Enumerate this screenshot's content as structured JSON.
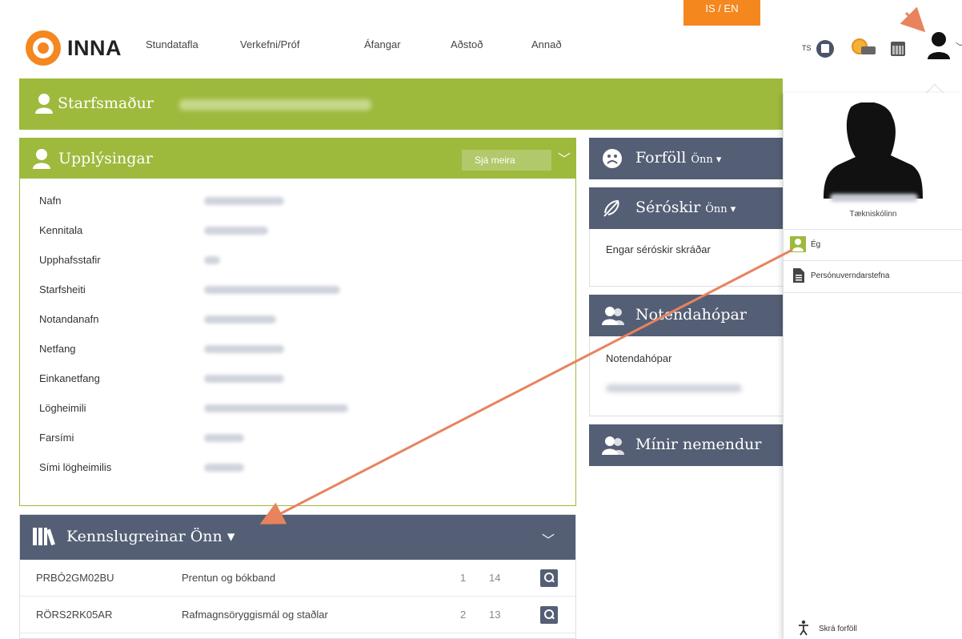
{
  "header": {
    "lang_label": "IS / EN",
    "logo_text": "INNA",
    "nav": [
      "Stundatafla",
      "Verkefni/Próf",
      "Áfangar",
      "Aðstoð",
      "Annað"
    ],
    "ts_label": "TS"
  },
  "employee": {
    "title": "Starfsmaður"
  },
  "info_card": {
    "title": "Upplýsingar",
    "more_button": "Sjá meira",
    "rows": [
      "Nafn",
      "Kennitala",
      "Upphafsstafir",
      "Starfsheiti",
      "Notandanafn",
      "Netfang",
      "Einkanetfang",
      "Lögheimili",
      "Farsími",
      "Sími lögheimilis"
    ]
  },
  "courses_card": {
    "title": "Kennslugreinar",
    "term": "Önn",
    "rows": [
      {
        "code": "PRBÓ2GM02BU",
        "name": "Prentun og bókband",
        "n1": "1",
        "n2": "14"
      },
      {
        "code": "RÖRS2RK05AR",
        "name": "Rafmagnsöryggismál og staðlar",
        "n1": "2",
        "n2": "13"
      }
    ]
  },
  "absence_card": {
    "title": "Forföll",
    "term": "Önn"
  },
  "special_card": {
    "title": "Séróskir",
    "term": "Önn",
    "empty_text": "Engar séróskir skráðar"
  },
  "groups_card": {
    "title": "Notendahópar",
    "label": "Notendahópar"
  },
  "students_card": {
    "title": "Mínir nemendur"
  },
  "user_menu": {
    "school": "Tækniskólinn",
    "items": [
      "Ég",
      "Persónuverndarstefna"
    ],
    "footer_item": "Skrá forföll"
  },
  "colors": {
    "green": "#9dba3c",
    "slate": "#545f75",
    "orange": "#f5871f",
    "arrow": "#e8835e"
  }
}
